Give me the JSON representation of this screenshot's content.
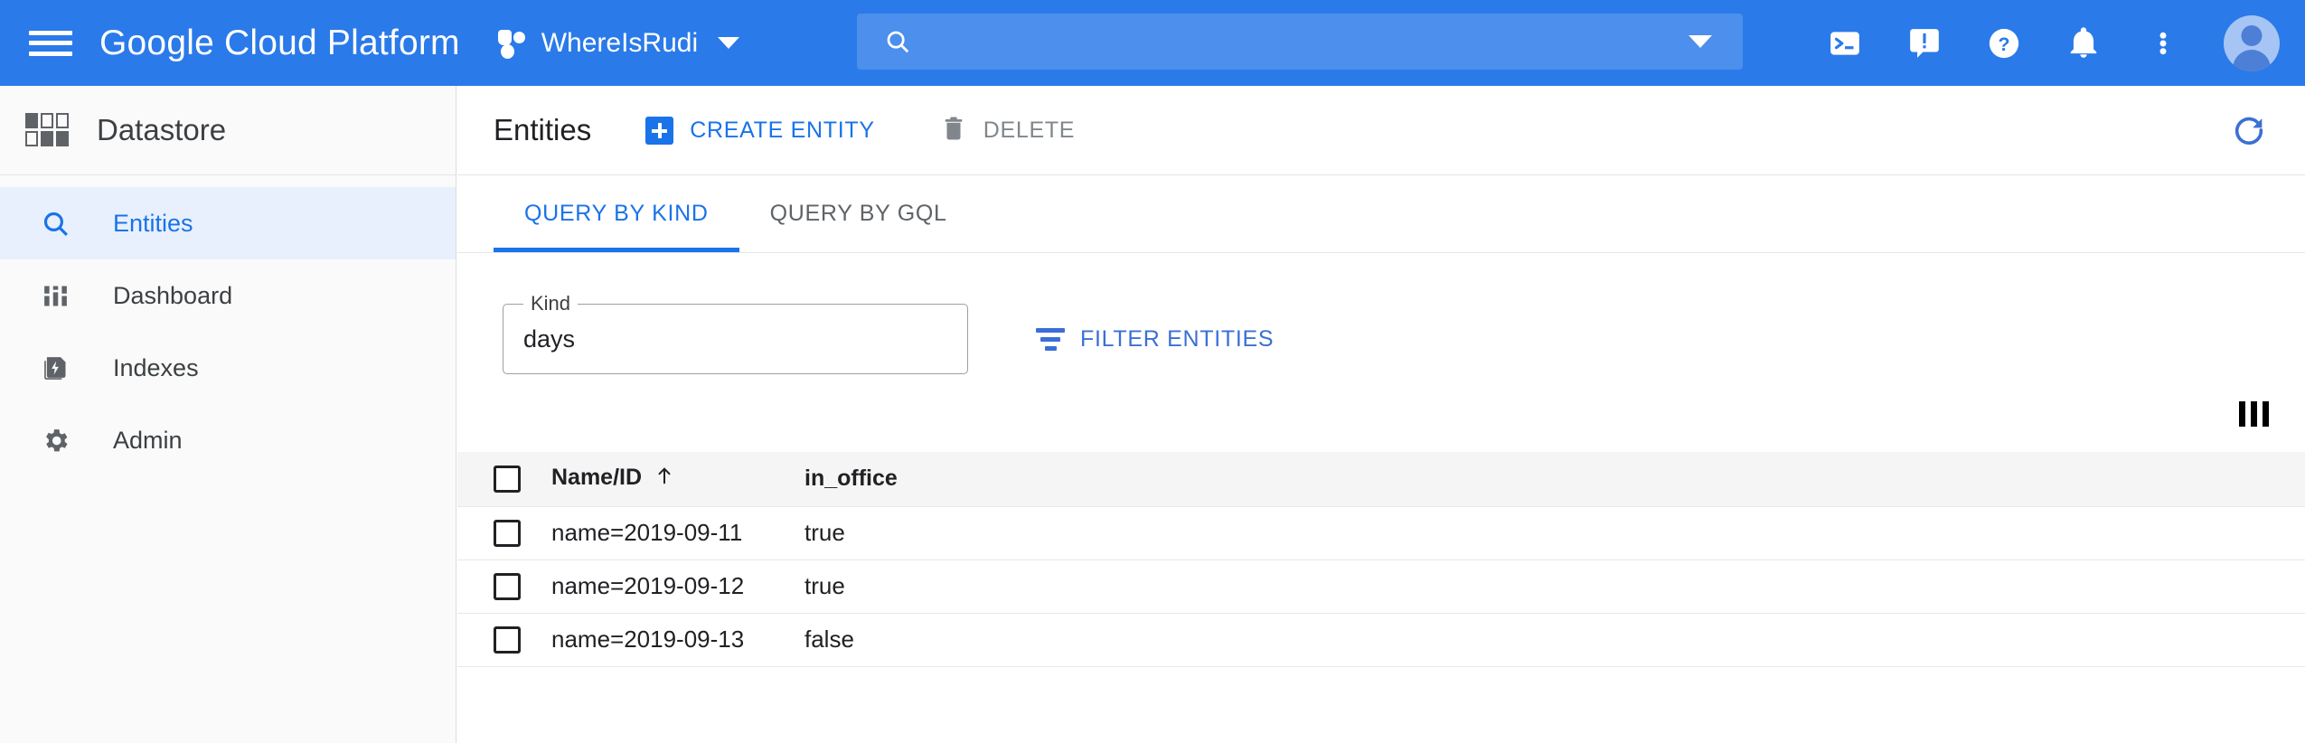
{
  "topbar": {
    "menu_icon": "hamburger-menu-icon",
    "brand": "Google Cloud Platform",
    "project_name": "WhereIsRudi",
    "project_icon": "project-icon",
    "project_caret_icon": "chevron-down-icon",
    "search": {
      "value": "",
      "placeholder": "",
      "icon": "search-icon",
      "caret_icon": "chevron-down-icon"
    },
    "actions": [
      {
        "name": "cloud-shell-icon",
        "title": "Activate Cloud Shell"
      },
      {
        "name": "feedback-icon",
        "title": "Send feedback"
      },
      {
        "name": "help-icon",
        "title": "Help"
      },
      {
        "name": "notifications-icon",
        "title": "Notifications"
      },
      {
        "name": "more-options-icon",
        "title": "More options"
      }
    ],
    "avatar": "account-avatar"
  },
  "sidebar": {
    "product_icon": "datastore-grid-icon",
    "product_title": "Datastore",
    "items": [
      {
        "label": "Entities",
        "icon": "search-icon",
        "active": true
      },
      {
        "label": "Dashboard",
        "icon": "dashboard-icon",
        "active": false
      },
      {
        "label": "Indexes",
        "icon": "indexes-icon",
        "active": false
      },
      {
        "label": "Admin",
        "icon": "gear-icon",
        "active": false
      }
    ]
  },
  "main": {
    "page_title": "Entities",
    "create_entity_label": "CREATE ENTITY",
    "delete_label": "DELETE",
    "refresh_icon": "refresh-icon",
    "tabs": [
      {
        "label": "QUERY BY KIND",
        "active": true
      },
      {
        "label": "QUERY BY GQL",
        "active": false
      }
    ],
    "query": {
      "kind_label": "Kind",
      "kind_value": "days",
      "kind_placeholder": "",
      "filter_entities_label": "FILTER ENTITIES",
      "filter_icon": "filter-icon"
    },
    "columns_button_icon": "view-columns-icon",
    "table": {
      "headers": [
        "",
        "Name/ID",
        "in_office"
      ],
      "sort_column": "Name/ID",
      "sort_direction": "ascending",
      "rows": [
        {
          "name": "name=2019-09-11",
          "in_office": "true"
        },
        {
          "name": "name=2019-09-12",
          "in_office": "true"
        },
        {
          "name": "name=2019-09-13",
          "in_office": "false"
        }
      ]
    }
  },
  "colors": {
    "header_blue": "#2a7ae9",
    "accent_blue": "#1a73e8",
    "active_nav_bg": "#e8f0fe",
    "muted_text": "#5f6368",
    "table_header_bg": "#f5f5f5"
  }
}
